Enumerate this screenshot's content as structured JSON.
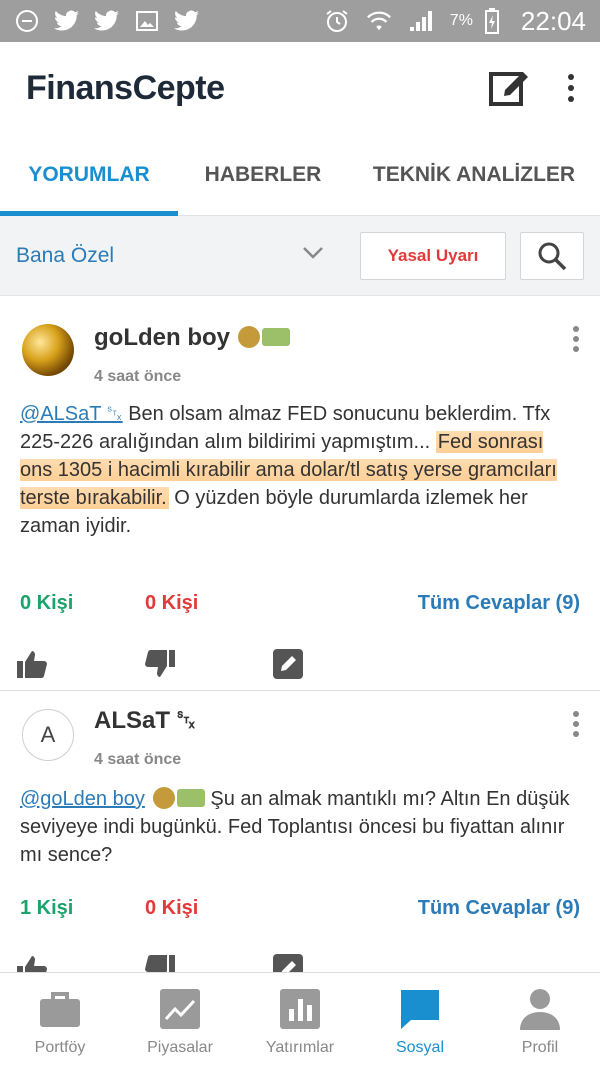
{
  "status_bar": {
    "battery_percent": "7%",
    "time": "22:04"
  },
  "app": {
    "title": "FinansCepte"
  },
  "tabs": [
    {
      "label": "YORUMLAR",
      "active": true
    },
    {
      "label": "HABERLER",
      "active": false
    },
    {
      "label": "TEKNİK ANALİZLER",
      "active": false
    }
  ],
  "filter": {
    "selected": "Bana Özel",
    "legal_label": "Yasal Uyarı"
  },
  "posts": [
    {
      "author": "goLden boy",
      "time": "4 saat önce",
      "mention": "@ALSaT ␂",
      "text_plain": " Ben olsam almaz FED sonucunu beklerdim. Tfx 225-226 aralığından alım bildirimi yapmıştım... ",
      "text_highlight": "Fed sonrası ons 1305 i hacimli kırabilir ama dolar/tl satış yerse gramcıları terste bırakabilir.",
      "text_tail": " O yüzden böyle durumlarda izlemek her zaman iyidir.",
      "likes": "0 Kişi",
      "dislikes": "0 Kişi",
      "replies": "Tüm Cevaplar (9)"
    },
    {
      "author": "ALSaT ␂",
      "avatar_letter": "A",
      "time": "4 saat önce",
      "mention": "@goLden boy",
      "text_plain": " Şu an almak mantıklı mı? Altın En düşük seviyeye indi bugünkü. Fed Toplantısı öncesi bu fiyattan alınır mı sence?",
      "likes": "1 Kişi",
      "dislikes": "0 Kişi",
      "replies": "Tüm Cevaplar (9)"
    }
  ],
  "bottom_nav": [
    {
      "label": "Portföy",
      "icon": "briefcase-icon",
      "active": false
    },
    {
      "label": "Piyasalar",
      "icon": "trend-chart-icon",
      "active": false
    },
    {
      "label": "Yatırımlar",
      "icon": "bar-chart-icon",
      "active": false
    },
    {
      "label": "Sosyal",
      "icon": "chat-bubble-icon",
      "active": true
    },
    {
      "label": "Profil",
      "icon": "person-icon",
      "active": false
    }
  ],
  "colors": {
    "accent": "#1a8fd0",
    "like": "#1aa36a",
    "dislike": "#e23a3a",
    "status_bar": "#9e9e9e"
  }
}
